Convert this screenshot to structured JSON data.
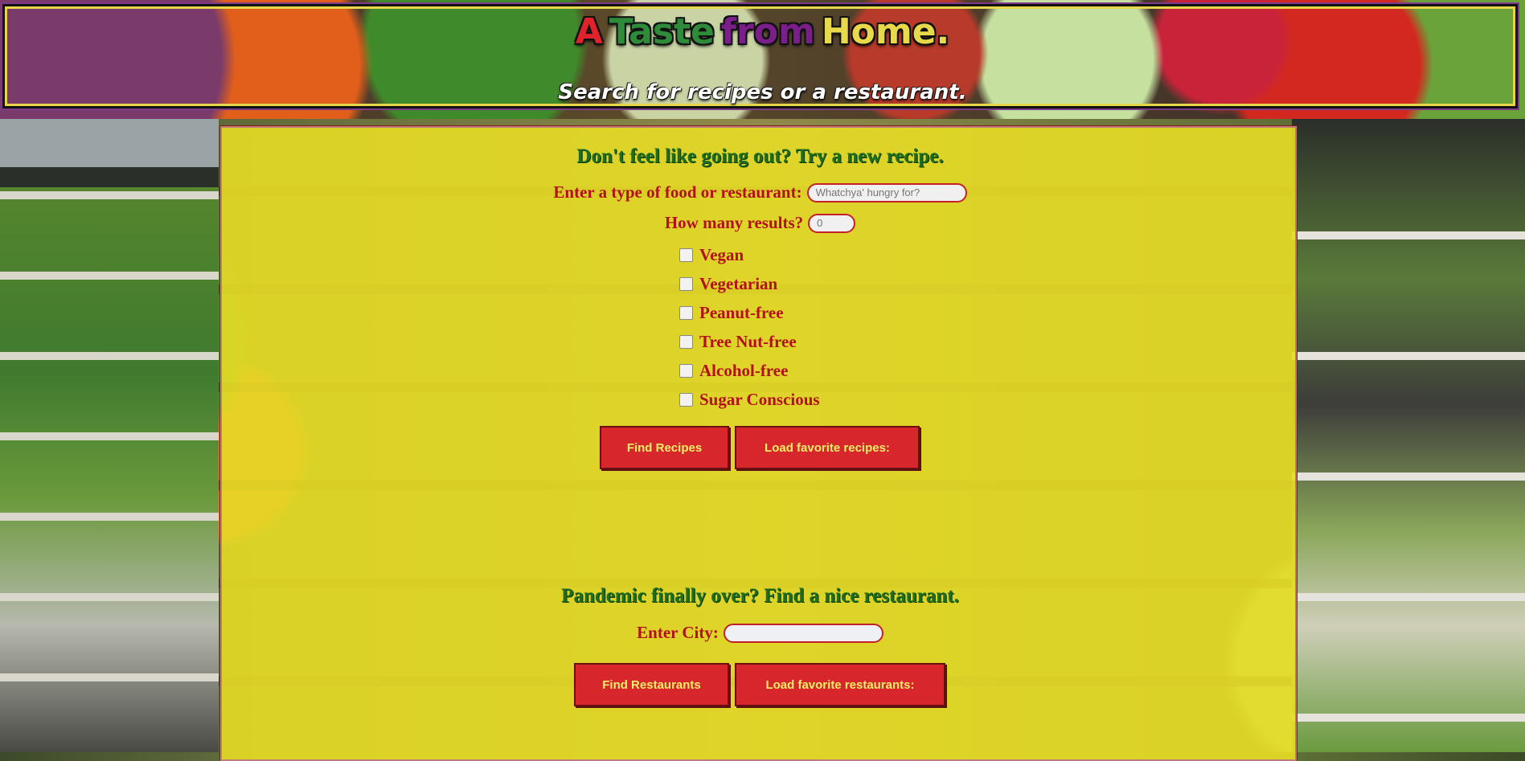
{
  "header": {
    "brand_words": [
      {
        "text": "A",
        "color": "#e0232b"
      },
      {
        "text": "Taste",
        "color": "#2e8b3a"
      },
      {
        "text": "from",
        "color": "#7a1f8a"
      },
      {
        "text": "Home.",
        "color": "#e8d94a"
      }
    ],
    "tagline": "Search for recipes or a restaurant."
  },
  "recipes": {
    "title": "Don't feel like going out? Try a new recipe.",
    "food_label": "Enter a type of food or restaurant:",
    "food_placeholder": "Whatchya' hungry for?",
    "results_label": "How many results?",
    "results_placeholder": "0",
    "filters": [
      "Vegan",
      "Vegetarian",
      "Peanut-free",
      "Tree Nut-free",
      "Alcohol-free",
      "Sugar Conscious"
    ],
    "find_button": "Find Recipes",
    "favorites_button": "Load favorite recipes:"
  },
  "restaurants": {
    "title": "Pandemic finally over? Find a nice restaurant.",
    "city_label": "Enter City:",
    "city_placeholder": "",
    "find_button": "Find Restaurants",
    "favorites_button": "Load favorite restaurants:"
  },
  "colors": {
    "panel": "#e8dd26",
    "title_green": "#1f6d1f",
    "label_red": "#b3111a",
    "button_red": "#d8262d",
    "button_text": "#f2ee66"
  }
}
